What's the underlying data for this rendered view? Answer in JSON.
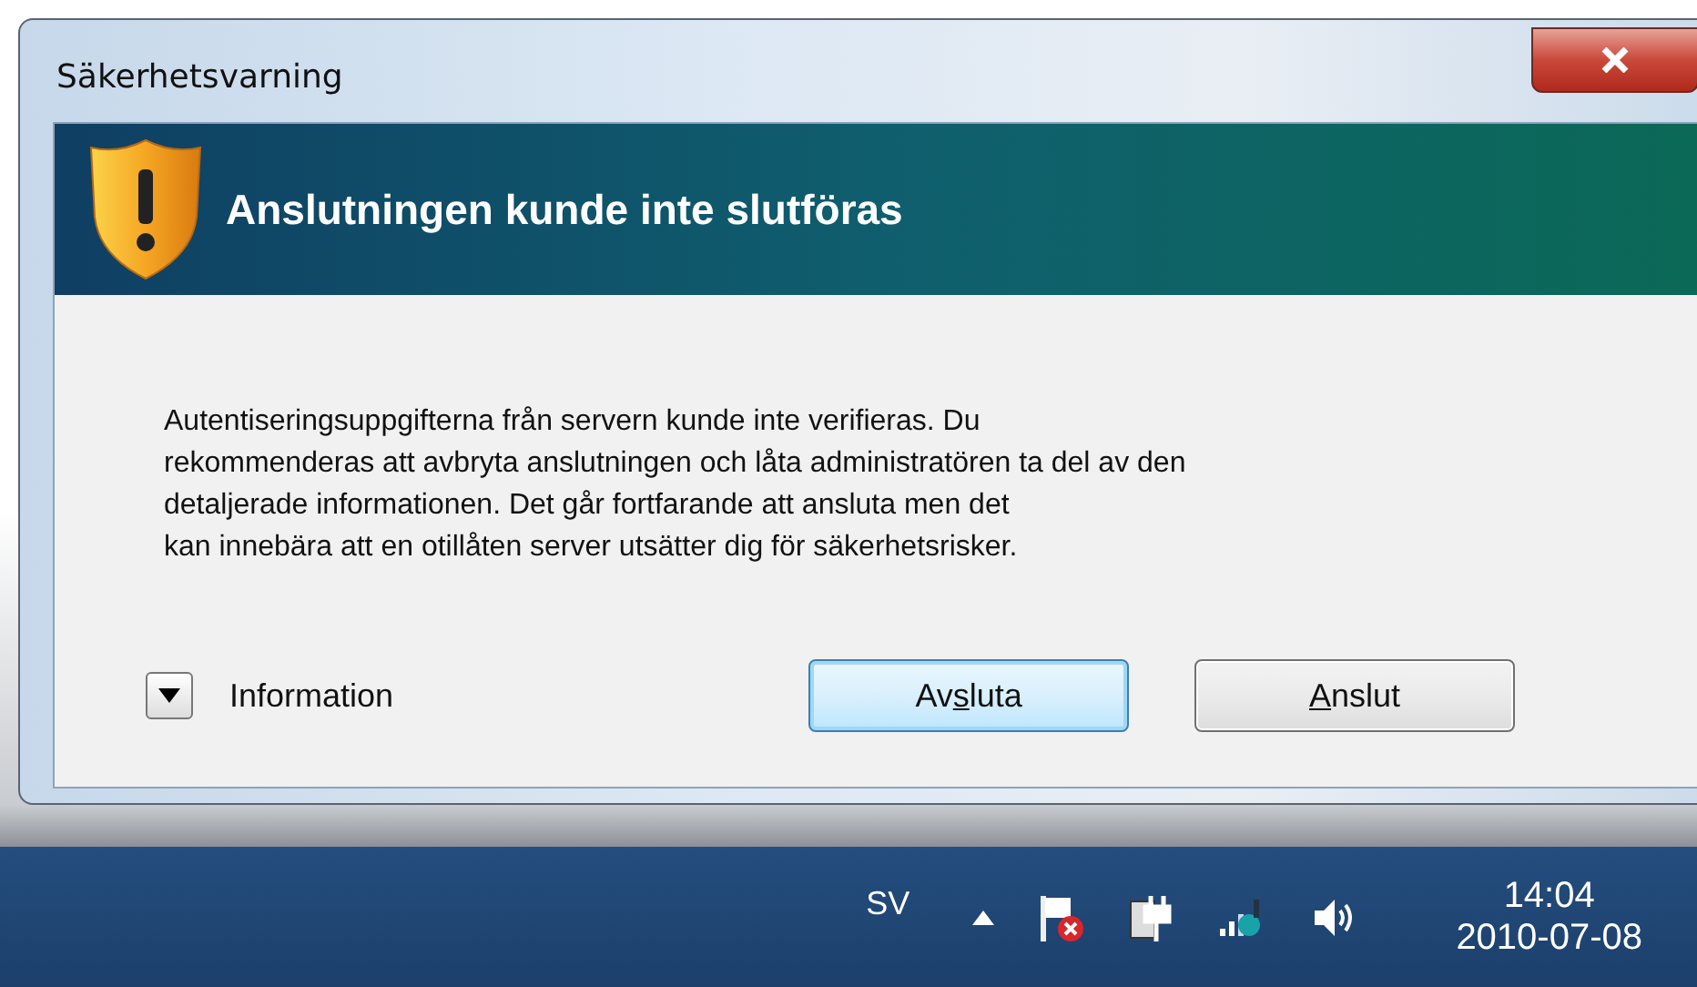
{
  "window": {
    "title": "Säkerhetsvarning"
  },
  "header": {
    "title": "Anslutningen kunde inte slutföras"
  },
  "message_lines": [
    "Autentiseringsuppgifterna från servern kunde inte verifieras. Du",
    "rekommenderas att avbryta anslutningen och låta administratören ta del av den",
    "detaljerade informationen. Det går fortfarande att ansluta men det",
    "kan innebära att en otillåten server utsätter dig för säkerhetsrisker."
  ],
  "details": {
    "label": "Information",
    "expanded": false
  },
  "buttons": [
    {
      "before": "Av",
      "access_key": "s",
      "after": "luta",
      "selected": true
    },
    {
      "access_key": "A",
      "after": "nslut",
      "selected": false
    }
  ],
  "taskbar": {
    "language": "SV",
    "time": "14:04",
    "date": "2010-07-08"
  }
}
